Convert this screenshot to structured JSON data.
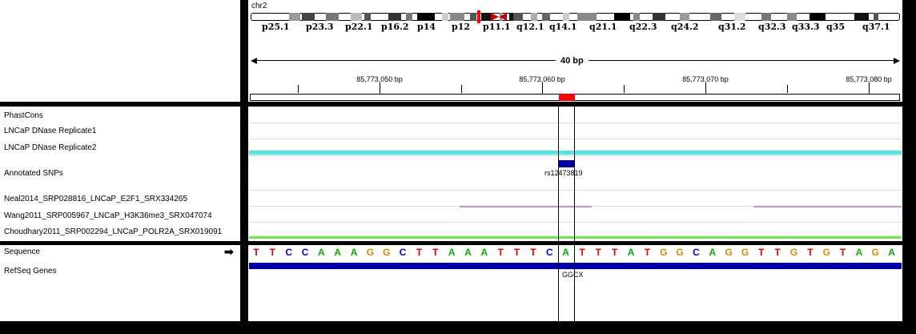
{
  "header": {
    "chromosome": "chr2",
    "ruler_span": "40 bp",
    "cytobands": [
      "p25.1",
      "p23.3",
      "p22.1",
      "p16.2",
      "p14",
      "p12",
      "p11.1",
      "q12.1",
      "q14.1",
      "q21.1",
      "q22.3",
      "q24.2",
      "q31.2",
      "q32.3",
      "q33.3",
      "q35",
      "q37.1"
    ],
    "positions": [
      "85,773,050 bp",
      "85,773,060 bp",
      "85,773,070 bp",
      "85,773,080 bp"
    ]
  },
  "tracks": {
    "data_tracks": [
      "PhastCons",
      "LNCaP DNase Replicate1",
      "LNCaP DNase Replicate2",
      "Annotated SNPs",
      "Neal2014_SRP028816_LNCaP_E2F1_SRX334265",
      "Wang2011_SRP005967_LNCaP_H3K36me3_SRX047074",
      "Choudhary2011_SRP002294_LNCaP_POLR2A_SRX019091"
    ],
    "feature_tracks": [
      "Sequence",
      "RefSeq Genes"
    ]
  },
  "snp": {
    "id": "rs12473819"
  },
  "gene": {
    "label": "GGCX"
  },
  "sequence": {
    "bases": [
      "T",
      "T",
      "C",
      "C",
      "A",
      "A",
      "A",
      "G",
      "G",
      "C",
      "T",
      "T",
      "A",
      "A",
      "A",
      "T",
      "T",
      "T",
      "C",
      "A",
      "T",
      "T",
      "T",
      "A",
      "T",
      "G",
      "G",
      "C",
      "A",
      "G",
      "G",
      "T",
      "T",
      "G",
      "T",
      "G",
      "T",
      "A",
      "G",
      "A"
    ],
    "colors": {
      "A": "#00b000",
      "C": "#0000e0",
      "G": "#d18e00",
      "T": "#e00000"
    }
  },
  "colors": {
    "dnase_rep2": "#4ee8e8",
    "h3k36me3": "#cc88dd",
    "polr2a": "#66ee44",
    "snp": "#0000aa",
    "refseq": "#0000aa",
    "roi": "#ff0000"
  },
  "icons": {
    "strand": "right-arrow-icon"
  }
}
